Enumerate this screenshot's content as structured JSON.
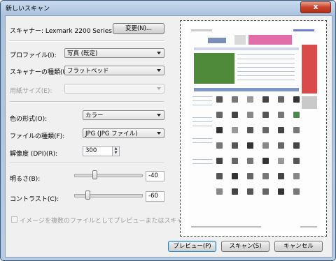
{
  "window": {
    "title": "新しいスキャン",
    "close_label": "x"
  },
  "scanner": {
    "label": "スキャナー: Lexmark 2200 Series",
    "change_button": "変更(N)..."
  },
  "profile": {
    "label": "プロファイル(I):",
    "value": "写真 (既定)"
  },
  "source": {
    "label": "スキャナーの種類(U):",
    "value": "フラットベッド"
  },
  "paper_size": {
    "label": "用紙サイズ(E):",
    "value": ""
  },
  "color_format": {
    "label": "色の形式(O):",
    "value": "カラー"
  },
  "file_type": {
    "label": "ファイルの種類(F):",
    "value": "JPG (JPG ファイル)"
  },
  "resolution": {
    "label": "解像度 (DPI)(R):",
    "value": "300"
  },
  "brightness": {
    "label": "明るさ(B):",
    "value": "-40",
    "level": -40,
    "range": [
      -100,
      100
    ]
  },
  "contrast": {
    "label": "コントラスト(C):",
    "value": "-60",
    "level": -60,
    "range": [
      -100,
      100
    ]
  },
  "separate_files": {
    "label": "イメージを複数のファイルとしてプレビューまたはスキャンする(T)",
    "checked": false
  },
  "buttons": {
    "preview": "プレビュー(P)",
    "scan": "スキャン(S)",
    "cancel": "キャンセル"
  },
  "colors": {
    "accent_default": "#3c7fb1",
    "titlebar": "#b7cbe3",
    "close": "#c9432a"
  }
}
